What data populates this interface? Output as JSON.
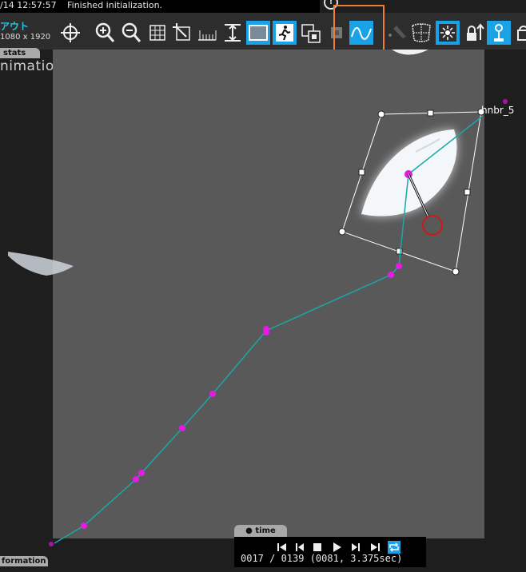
{
  "status": {
    "time": "/14 12:57:57",
    "message": "Finished initialization."
  },
  "header": {
    "title": "アウト",
    "resolution": "1080 x 1920"
  },
  "tabs": {
    "stats": "stats",
    "time": "time",
    "information": "formation"
  },
  "viewport": {
    "mode_label": "nimation",
    "layer_label": "hnbr_5"
  },
  "timeline": {
    "readout": "0017 / 0139 (0081, 3.375sec)"
  },
  "colors": {
    "accent": "#19a2e6",
    "highlight": "#f07d33",
    "motion_path": "#19a8a8",
    "keyframe": "#e619e6",
    "pivot_ring": "#cc1a1a"
  },
  "icons": [
    "crosshair-icon",
    "zoom-in-icon",
    "zoom-out-icon",
    "grid-icon",
    "crop-icon",
    "ruler-icon",
    "fit-height-icon",
    "frame-icon",
    "runner-icon",
    "layer-copy-icon",
    "mask-icon",
    "curve-icon",
    "pen-icon",
    "mesh-icon",
    "burst-icon",
    "lock-arrow-icon",
    "pin-icon",
    "bag-icon"
  ]
}
